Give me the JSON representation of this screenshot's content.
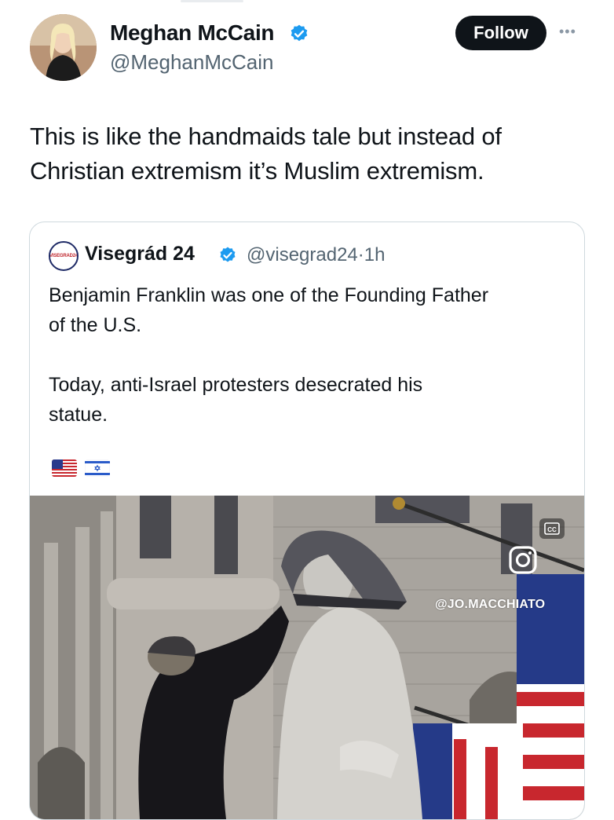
{
  "post": {
    "author_name": "Meghan McCain",
    "author_handle": "@MeghanMcCain",
    "follow_label": "Follow",
    "more_label": "•••",
    "text_line1": "This is like the handmaids tale but instead of",
    "text_line2": "Christian extremism it’s Muslim extremism."
  },
  "quoted": {
    "avatar_text": "VISEGRAD24",
    "name": "Visegrád 24",
    "handle": "@visegrad24",
    "separator": "·",
    "time": "1h",
    "paragraph1_line1": "Benjamin Franklin was one of the Founding Father",
    "paragraph1_line2": "of the U.S.",
    "paragraph2_line1": "Today, anti-Israel protesters desecrated his",
    "paragraph2_line2": "statue.",
    "flags": [
      "us-flag-icon",
      "israel-flag-icon"
    ],
    "media": {
      "watermark": "@JO.MACCHIATO"
    }
  },
  "colors": {
    "text": "#0f1419",
    "secondary": "#536471",
    "verified": "#1d9bf0",
    "follow_bg": "#0f1419",
    "border": "#cfd9de"
  }
}
